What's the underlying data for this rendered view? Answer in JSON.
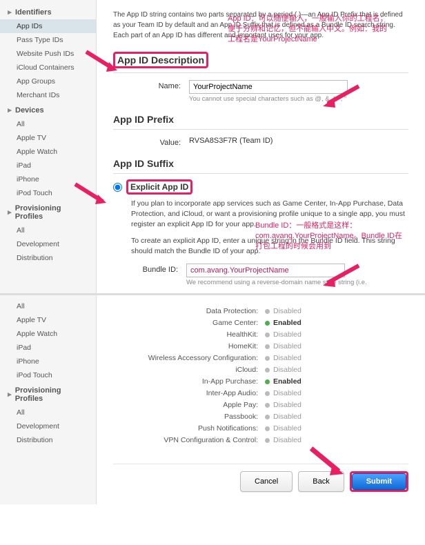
{
  "sidebar": {
    "groups": [
      {
        "header": "Identifiers",
        "items": [
          "App IDs",
          "Pass Type IDs",
          "Website Push IDs",
          "iCloud Containers",
          "App Groups",
          "Merchant IDs"
        ],
        "selected": 0
      },
      {
        "header": "Devices",
        "items": [
          "All",
          "Apple TV",
          "Apple Watch",
          "iPad",
          "iPhone",
          "iPod Touch"
        ]
      },
      {
        "header": "Provisioning Profiles",
        "items": [
          "All",
          "Development",
          "Distribution"
        ]
      }
    ]
  },
  "intro": "The App ID string contains two parts separated by a period (.)—an App ID Prefix that is defined as your Team ID by default and an App ID Suffix that is defined as a Bundle ID search string. Each part of an App ID has different and important uses for your app.",
  "desc": {
    "title": "App ID Description",
    "name_label": "Name:",
    "name_value": "YourProjectName",
    "name_hint": "You cannot use special characters such as @, &, *, ', \""
  },
  "prefix": {
    "title": "App ID Prefix",
    "value_label": "Value:",
    "value": "RVSA8S3F7R (Team ID)"
  },
  "suffix": {
    "title": "App ID Suffix",
    "explicit_label": "Explicit App ID",
    "explicit_p1": "If you plan to incorporate app services such as Game Center, In-App Purchase, Data Protection, and iCloud, or want a provisioning profile unique to a single app, you must register an explicit App ID for your app.",
    "explicit_p2": "To create an explicit App ID, enter a unique string in the Bundle ID field. This string should match the Bundle ID of your app.",
    "bundle_label": "Bundle ID:",
    "bundle_value": "com.avang.YourProjectName",
    "bundle_hint": "We recommend using a reverse-domain name style string (i.e."
  },
  "annotations": {
    "a1": "App ID：可以随便输入，一般输入你的工程名；便于分辨和记忆，但不能输入中文。例如：我的工程名是YourProjectName",
    "a2": "Bundle ID：一般格式是这样：com.avang.YourProjectName。Bundle ID在打包工程的时候会用到"
  },
  "sidebar2": {
    "groups": [
      {
        "header": "",
        "items": [
          "All",
          "Apple TV",
          "Apple Watch",
          "iPad",
          "iPhone",
          "iPod Touch"
        ]
      },
      {
        "header": "Provisioning Profiles",
        "items": [
          "All",
          "Development",
          "Distribution"
        ]
      }
    ]
  },
  "services": [
    {
      "label": "Data Protection:",
      "status": "Disabled",
      "enabled": false
    },
    {
      "label": "Game Center:",
      "status": "Enabled",
      "enabled": true
    },
    {
      "label": "HealthKit:",
      "status": "Disabled",
      "enabled": false
    },
    {
      "label": "HomeKit:",
      "status": "Disabled",
      "enabled": false
    },
    {
      "label": "Wireless Accessory Configuration:",
      "status": "Disabled",
      "enabled": false
    },
    {
      "label": "iCloud:",
      "status": "Disabled",
      "enabled": false
    },
    {
      "label": "In-App Purchase:",
      "status": "Enabled",
      "enabled": true
    },
    {
      "label": "Inter-App Audio:",
      "status": "Disabled",
      "enabled": false
    },
    {
      "label": "Apple Pay:",
      "status": "Disabled",
      "enabled": false
    },
    {
      "label": "Passbook:",
      "status": "Disabled",
      "enabled": false
    },
    {
      "label": "Push Notifications:",
      "status": "Disabled",
      "enabled": false
    },
    {
      "label": "VPN Configuration & Control:",
      "status": "Disabled",
      "enabled": false
    }
  ],
  "buttons": {
    "cancel": "Cancel",
    "back": "Back",
    "submit": "Submit"
  }
}
